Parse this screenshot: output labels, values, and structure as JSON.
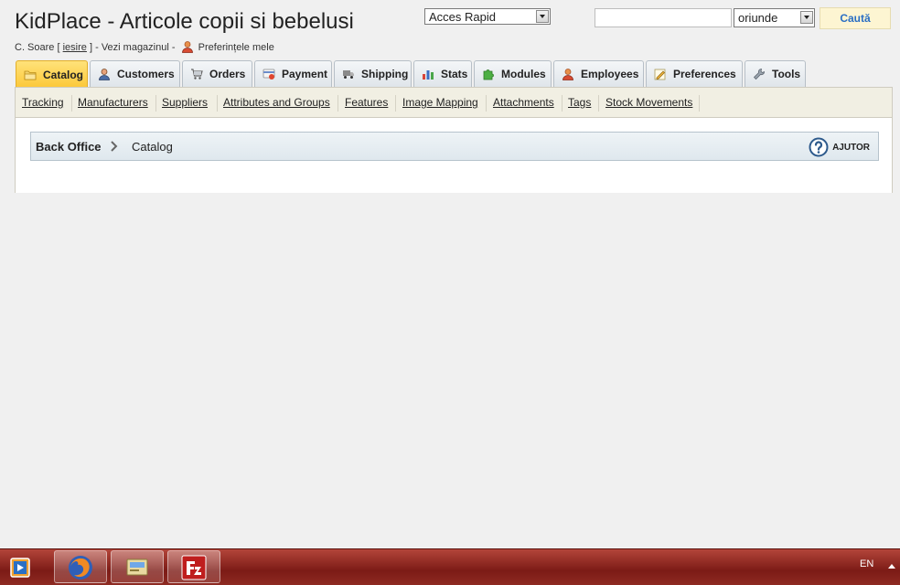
{
  "header": {
    "site_title": "KidPlace - Articole copii si bebelusi",
    "user_name": "C. Soare",
    "bracket_open": "[",
    "logout_label": "iesire",
    "bracket_close": "] -",
    "view_store_label": "Vezi magazinul -",
    "preferences_label": "Preferințele mele"
  },
  "quick_access": {
    "selected": "Acces Rapid"
  },
  "search": {
    "value": "",
    "scope_selected": "oriunde",
    "button_label": "Caută"
  },
  "tabs": [
    {
      "label": "Catalog",
      "icon": "folder-icon",
      "active": true
    },
    {
      "label": "Customers",
      "icon": "customer-icon"
    },
    {
      "label": "Orders",
      "icon": "cart-icon"
    },
    {
      "label": "Payment",
      "icon": "payment-icon"
    },
    {
      "label": "Shipping",
      "icon": "truck-icon"
    },
    {
      "label": "Stats",
      "icon": "stats-icon"
    },
    {
      "label": "Modules",
      "icon": "puzzle-icon"
    },
    {
      "label": "Employees",
      "icon": "employee-icon"
    },
    {
      "label": "Preferences",
      "icon": "preferences-icon"
    },
    {
      "label": "Tools",
      "icon": "wrench-icon"
    }
  ],
  "subnav": [
    "Tracking",
    "Manufacturers",
    "Suppliers",
    "Attributes and Groups",
    "Features",
    "Image Mapping",
    "Attachments",
    "Tags",
    "Stock Movements"
  ],
  "breadcrumb": {
    "root": "Back Office",
    "current": "Catalog",
    "help_label": "AJUTOR"
  },
  "taskbar": {
    "language": "EN",
    "apps": [
      "firefox-icon",
      "control-panel-icon",
      "filezilla-icon"
    ]
  },
  "colors": {
    "active_tab": "#fcc838",
    "search_button_text": "#2a6fc4",
    "taskbar": "#8e2a22"
  }
}
